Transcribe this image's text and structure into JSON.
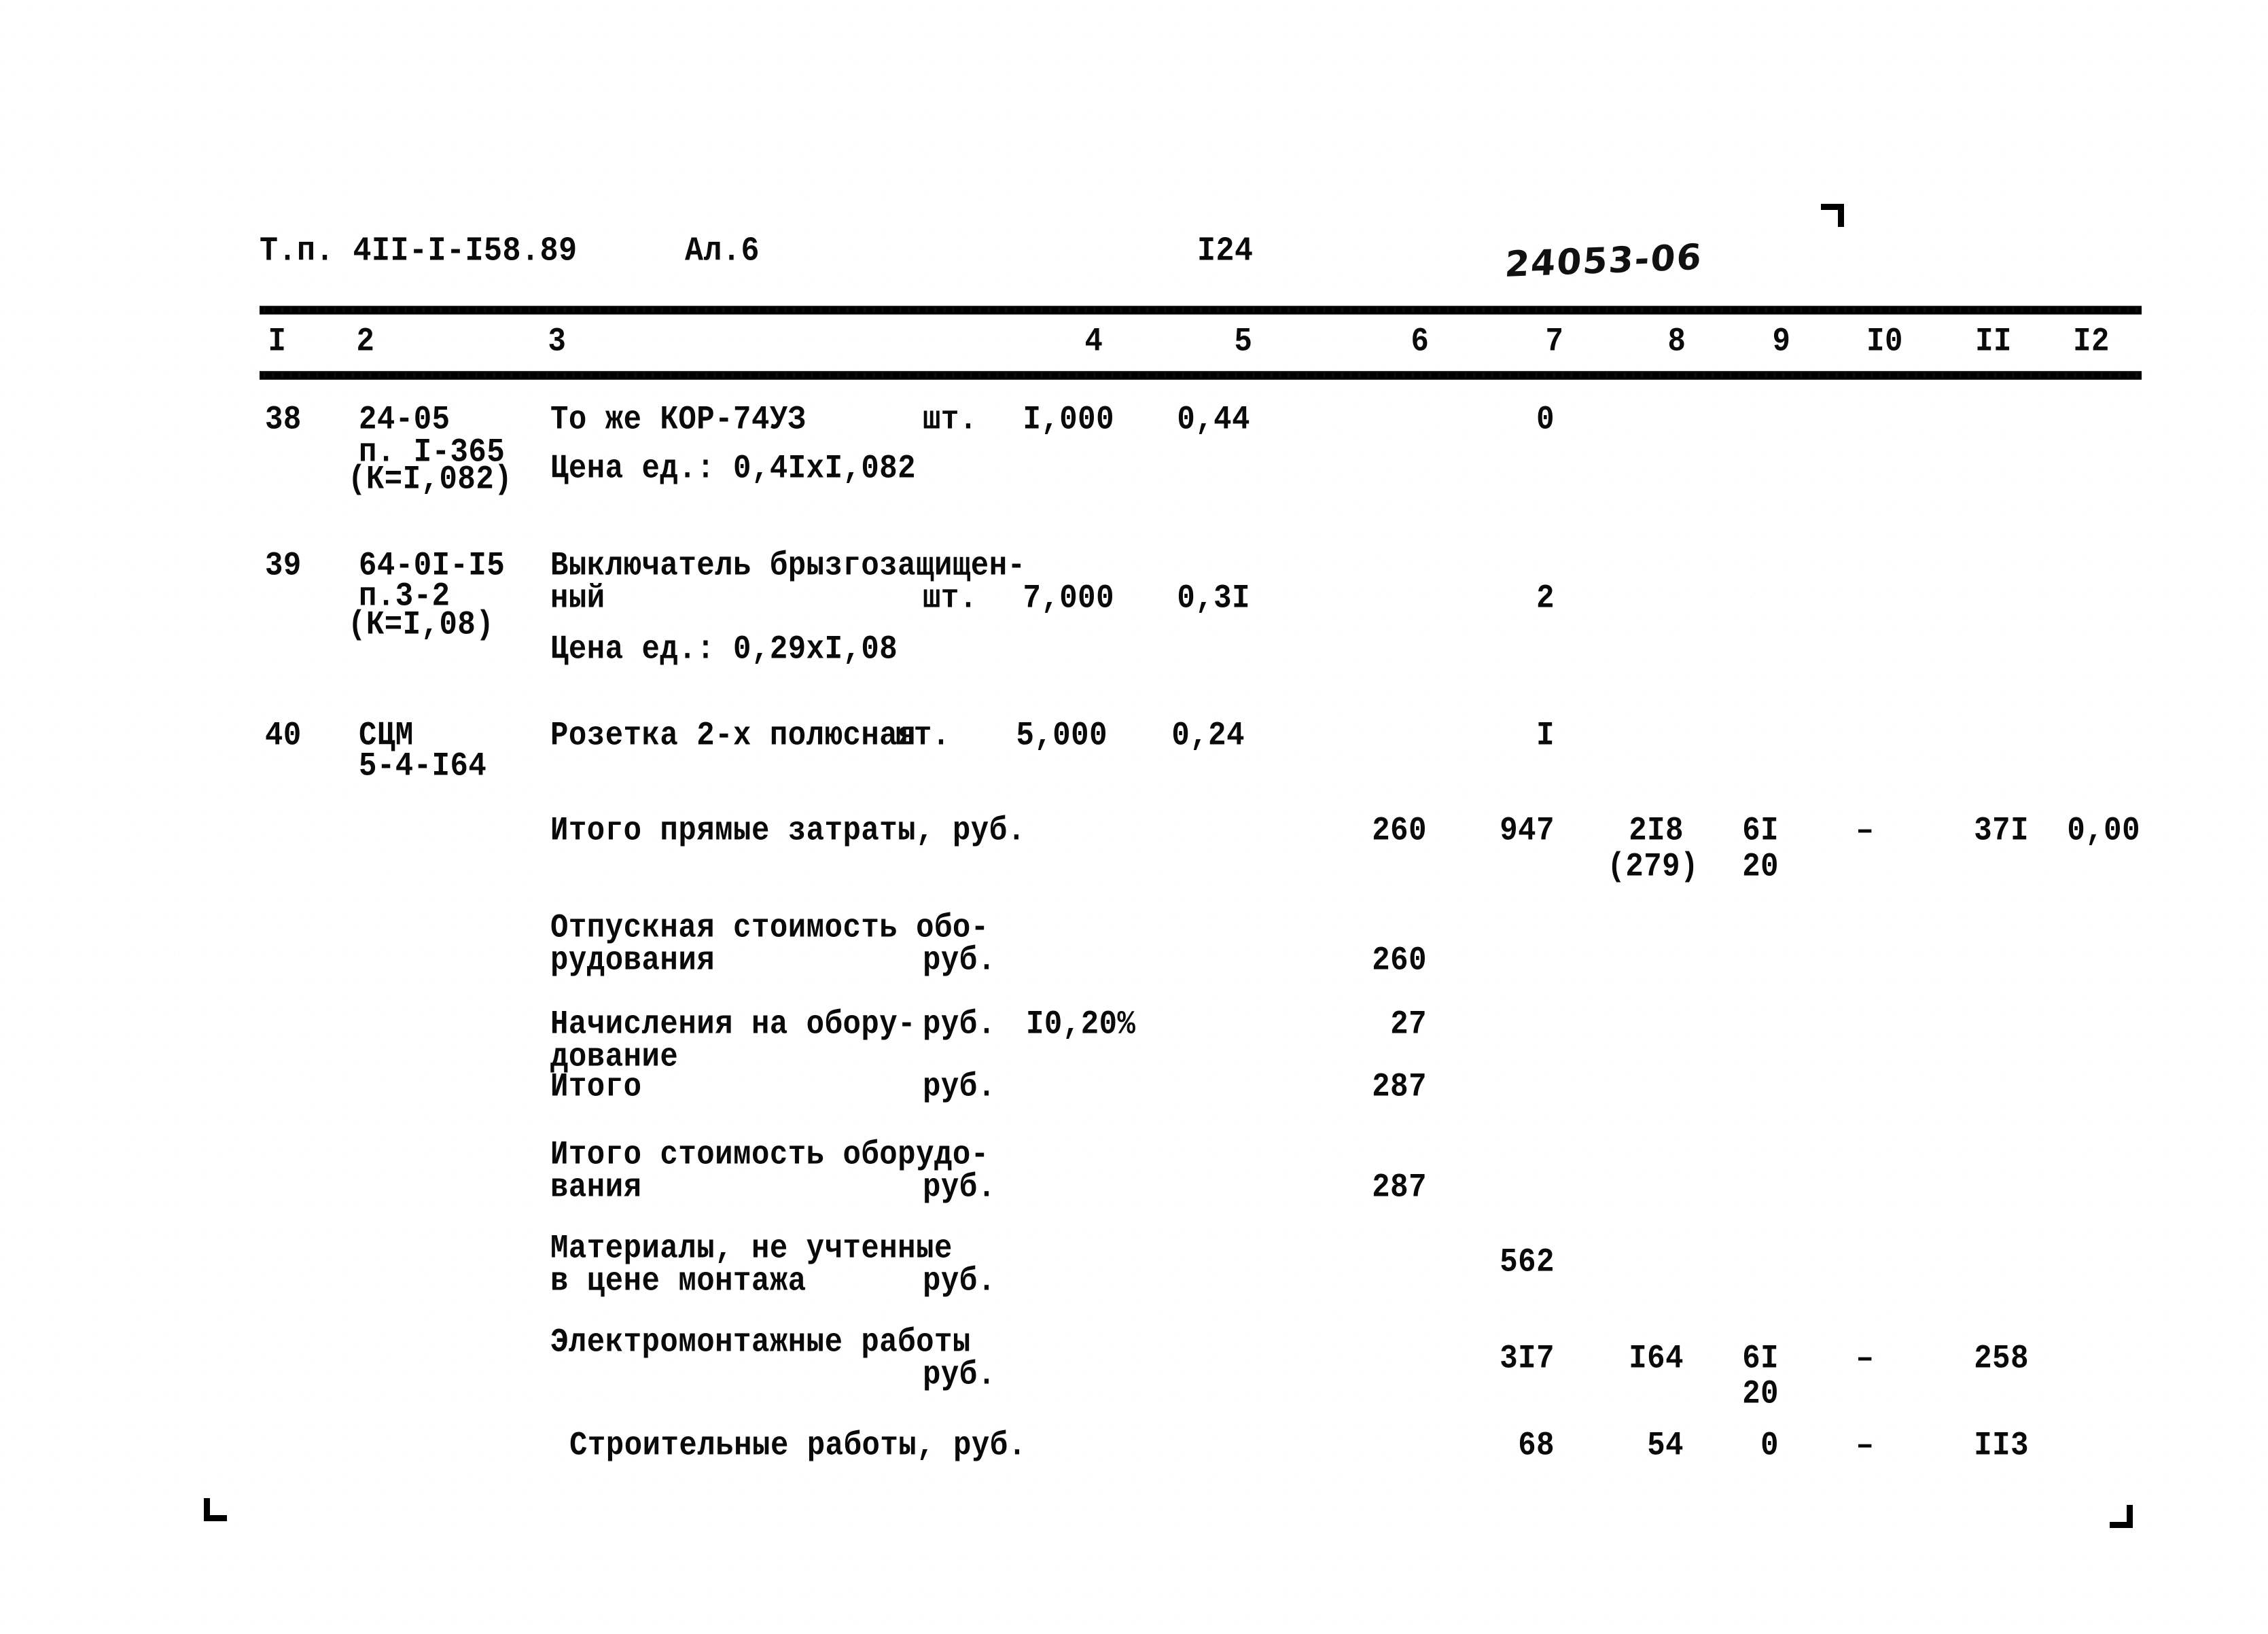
{
  "document": {
    "header": {
      "project_code": "Т.п. 4II-I-I58.89",
      "album": "Ал.6",
      "page_number": "I24",
      "handwritten_annotation": "24053-06"
    },
    "column_numbers": [
      "I",
      "2",
      "3",
      "4",
      "5",
      "6",
      "7",
      "8",
      "9",
      "I0",
      "II",
      "I2"
    ],
    "rows": [
      {
        "num": "38",
        "code_line1": "24-05",
        "code_line2": "п. I-365",
        "code_line3": "(К=I,082)",
        "desc_line1": "То же КОР-74УЗ",
        "unit": "шт.",
        "desc_line2": "Цена ед.: 0,4IxI,082",
        "c4": "I,000",
        "c5": "0,44",
        "c6": "",
        "c7": "0"
      },
      {
        "num": "39",
        "code_line1": "64-0I-I5",
        "code_line2": "п.3-2",
        "code_line3": "(К=I,08)",
        "desc_line1": "Выключатель брызгозащищен-",
        "desc_line1b": "ный",
        "unit": "шт.",
        "desc_line2": "Цена ед.: 0,29xI,08",
        "c4": "7,000",
        "c5": "0,3I",
        "c6": "",
        "c7": "2"
      },
      {
        "num": "40",
        "code_line1": "СЦМ",
        "code_line2": "5-4-I64",
        "code_line3": "",
        "desc_line1": "Розетка 2-х полюсная",
        "unit": "шт.",
        "desc_line2": "",
        "c4": "5,000",
        "c5": "0,24",
        "c6": "",
        "c7": "I"
      }
    ],
    "summary": [
      {
        "label_line1": "Итого прямые затраты, руб.",
        "label_line2": "",
        "unit": "",
        "rate": "",
        "c6": "260",
        "c7": "947",
        "c8": "2I8",
        "c8_sub": "(279)",
        "c9": "6I",
        "c9_sub": "20",
        "c10": "–",
        "c11": "37I",
        "c12": "0,00"
      },
      {
        "label_line1": "Отпускная стоимость обо-",
        "label_line2": "рудования",
        "unit": "руб.",
        "rate": "",
        "c6": "260",
        "c7": "",
        "c8": "",
        "c8_sub": "",
        "c9": "",
        "c9_sub": "",
        "c10": "",
        "c11": "",
        "c12": ""
      },
      {
        "label_line1": "Начисления на обору-",
        "label_line2": "дование",
        "unit": "руб.",
        "rate": "I0,20%",
        "c6": "27",
        "c7": "",
        "c8": "",
        "c8_sub": "",
        "c9": "",
        "c9_sub": "",
        "c10": "",
        "c11": "",
        "c12": ""
      },
      {
        "label_line1": "Итого",
        "label_line2": "",
        "unit": "руб.",
        "rate": "",
        "c6": "287",
        "c7": "",
        "c8": "",
        "c8_sub": "",
        "c9": "",
        "c9_sub": "",
        "c10": "",
        "c11": "",
        "c12": ""
      },
      {
        "label_line1": "Итого стоимость оборудо-",
        "label_line2": "вания",
        "unit": "руб.",
        "rate": "",
        "c6": "287",
        "c7": "",
        "c8": "",
        "c8_sub": "",
        "c9": "",
        "c9_sub": "",
        "c10": "",
        "c11": "",
        "c12": ""
      },
      {
        "label_line1": "Материалы, не учтенные",
        "label_line2": "в цене монтажа",
        "unit": "руб.",
        "rate": "",
        "c6": "",
        "c7": "562",
        "c8": "",
        "c8_sub": "",
        "c9": "",
        "c9_sub": "",
        "c10": "",
        "c11": "",
        "c12": ""
      },
      {
        "label_line1": "Электромонтажные работы",
        "label_line2": "",
        "unit": "руб.",
        "rate": "",
        "c6": "",
        "c7": "3I7",
        "c8": "I64",
        "c8_sub": "",
        "c9": "6I",
        "c9_sub": "20",
        "c10": "–",
        "c11": "258",
        "c12": ""
      },
      {
        "label_line1": "Строительные работы, руб.",
        "label_line2": "",
        "unit": "",
        "rate": "",
        "c6": "",
        "c7": "68",
        "c8": "54",
        "c8_sub": "",
        "c9": "0",
        "c9_sub": "",
        "c10": "–",
        "c11": "II3",
        "c12": ""
      }
    ]
  }
}
